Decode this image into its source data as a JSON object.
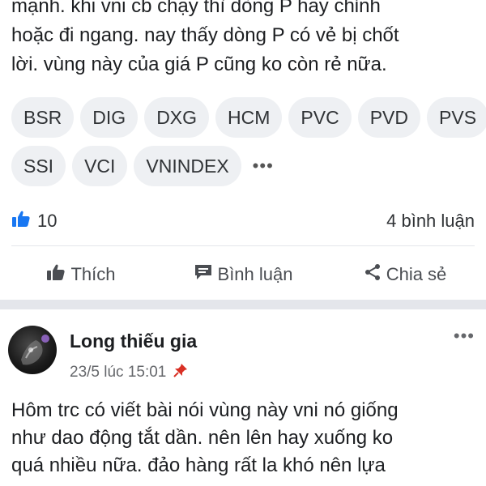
{
  "post1": {
    "text_lines": [
      "mạnh. khi vni cb chạy thì dòng P hay chỉnh",
      "hoặc đi ngang. nay thấy dòng P có vẻ bị chốt",
      "lời. vùng này của giá P cũng ko còn rẻ nữa."
    ],
    "tags_row1": [
      "BSR",
      "DIG",
      "DXG",
      "HCM",
      "PVC",
      "PVD",
      "PVS"
    ],
    "tags_row2": [
      "SSI",
      "VCI",
      "VNINDEX"
    ],
    "more_tags": "•••",
    "like_count": "10",
    "comment_count": "4 bình luận",
    "actions": {
      "like": "Thích",
      "comment": "Bình luận",
      "share": "Chia sẻ"
    }
  },
  "post2": {
    "author": "Long thiếu gia",
    "time": "23/5 lúc 15:01",
    "more": "•••",
    "text_lines": [
      "Hôm trc có viết bài nói vùng này vni nó giống",
      "như dao động tắt dần. nên lên hay xuống ko",
      "quá nhiều nữa. đảo hàng rất la khó nên lựa"
    ]
  },
  "colors": {
    "like_blue": "#1877f2",
    "pin_red": "#d93025",
    "separator": "#e4e6eb",
    "tag_bg": "#eef0f3"
  },
  "icons": {
    "like_reaction": "thumbs-up-icon",
    "like": "thumbs-up-icon",
    "comment": "comment-icon",
    "share": "share-icon",
    "pin": "pin-icon"
  }
}
